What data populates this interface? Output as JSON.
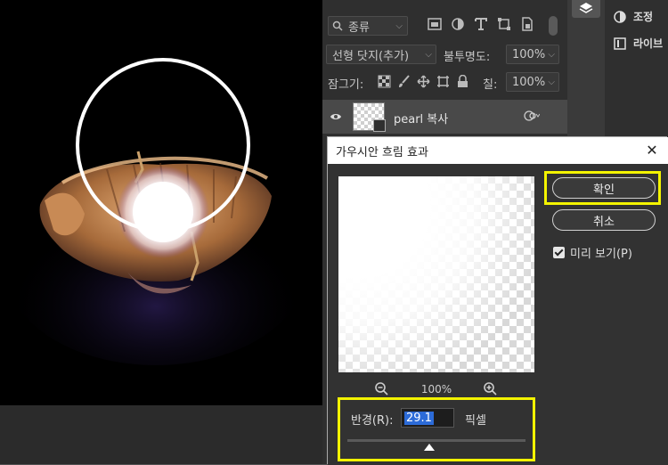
{
  "layers_panel": {
    "kind_filter": "종류",
    "blend_mode": "선형 닷지(추가)",
    "opacity_label": "불투명도:",
    "opacity_value": "100%",
    "lock_label": "잠그기:",
    "fill_label": "칠:",
    "fill_value": "100%",
    "layer": {
      "name": "pearl 복사"
    }
  },
  "side_panel": {
    "adjust_label": "조정",
    "library_label": "라이브"
  },
  "dialog": {
    "title": "가우시안 흐림 효과",
    "ok_label": "확인",
    "cancel_label": "취소",
    "preview_label": "미리 보기(P)",
    "zoom_value": "100%",
    "radius_label": "반경(R):",
    "radius_value": "29.1",
    "radius_unit": "픽셀",
    "radius_slider_fraction": 0.46
  },
  "colors": {
    "highlight": "#f3f300",
    "selection": "#2c6bd8"
  }
}
